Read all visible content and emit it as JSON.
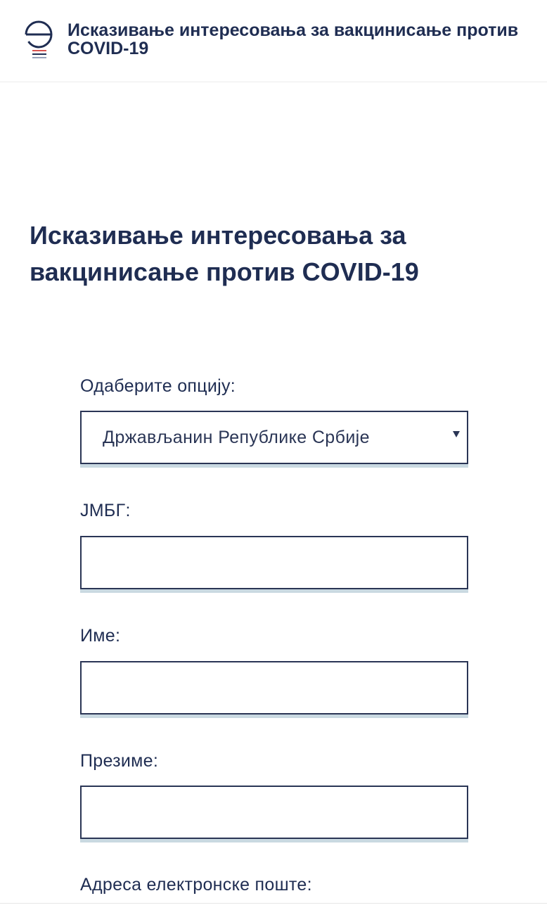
{
  "header": {
    "logo_icon": "e-gov-logo-icon",
    "title": "Исказивање интересовања за вакцинисање против COVID-19"
  },
  "main": {
    "title": "Исказивање интересовања за вакцинисање против COVID-19"
  },
  "form": {
    "option_label": "Одаберите опцију:",
    "option_value": "Држављанин Републике Србије",
    "jmbg_label": "ЈМБГ:",
    "jmbg_value": "",
    "first_name_label": "Име:",
    "first_name_value": "",
    "last_name_label": "Презиме:",
    "last_name_value": "",
    "email_label": "Адреса електронске поште:"
  },
  "colors": {
    "primary_text": "#1f2d52",
    "field_border": "#2a3555",
    "field_shadow": "#c9d9e1",
    "logo_red": "#d9534f"
  }
}
